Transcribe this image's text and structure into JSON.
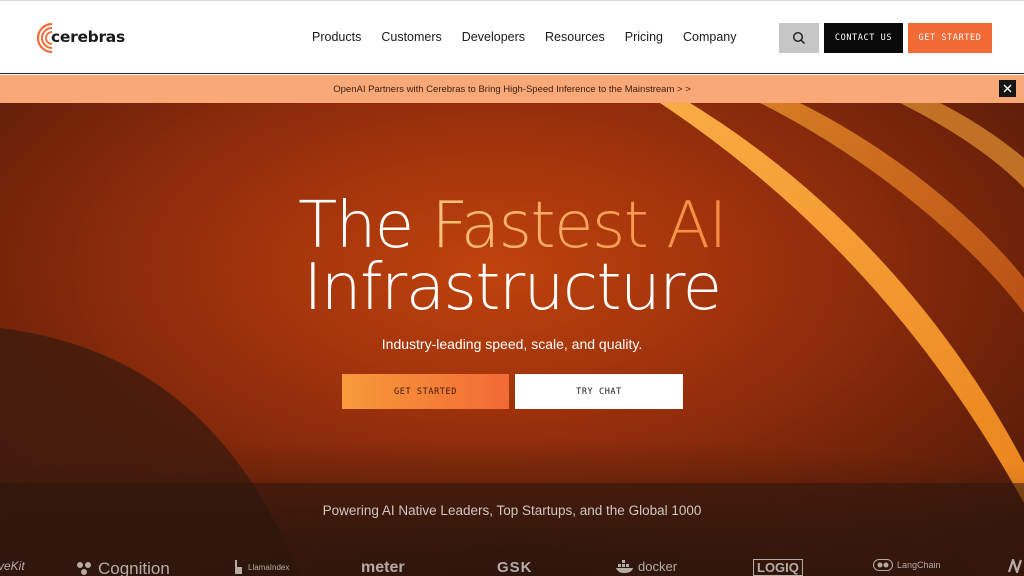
{
  "brand": {
    "name": "cerebras",
    "accent": "#f26a35"
  },
  "nav": [
    {
      "label": "Products"
    },
    {
      "label": "Customers"
    },
    {
      "label": "Developers"
    },
    {
      "label": "Resources"
    },
    {
      "label": "Pricing"
    },
    {
      "label": "Company"
    }
  ],
  "header": {
    "search_icon": "search-icon",
    "contact_label": "CONTACT US",
    "get_started_label": "GET STARTED"
  },
  "announcement": {
    "text": "OpenAI Partners with Cerebras to Bring High-Speed Inference to the Mainstream > >",
    "close_icon": "close-icon"
  },
  "hero": {
    "title_part1": "The ",
    "title_accent": "Fastest AI",
    "title_line2": "Infrastructure",
    "subtitle": "Industry-leading speed, scale, and quality.",
    "cta_primary": "GET STARTED",
    "cta_secondary": "TRY CHAT",
    "powering": "Powering AI Native Leaders, Top Startups, and the Global 1000"
  },
  "customer_logos": [
    {
      "name": "veKit"
    },
    {
      "name": "Cognition"
    },
    {
      "name": "LlamaIndex"
    },
    {
      "name": "meter"
    },
    {
      "name": "GSK"
    },
    {
      "name": "docker"
    },
    {
      "name": "LOGIQ"
    },
    {
      "name": "LangChain"
    }
  ]
}
